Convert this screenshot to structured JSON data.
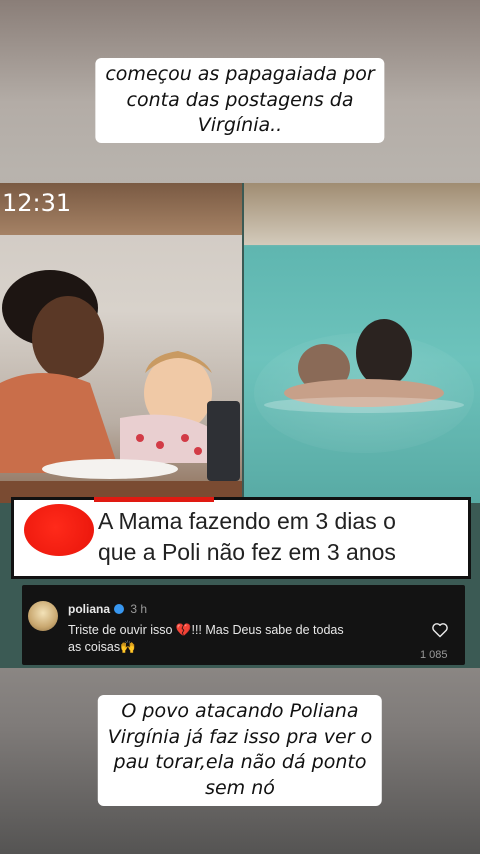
{
  "caption_top": {
    "lines": [
      "começou as papagaiada por",
      "conta das postagens da",
      "Virgínia.."
    ]
  },
  "video": {
    "status_time": "12:31"
  },
  "comment": {
    "lines": [
      "A Mama fazendo em 3 dias o",
      "que a Poli não fez em 3 anos"
    ]
  },
  "reply": {
    "username": "poliana",
    "time": "3 h",
    "lines": [
      "Triste de ouvir isso 💔!!! Mas Deus sabe de todas",
      "as coisas🙌"
    ],
    "like_count": "1 085"
  },
  "caption_bottom": {
    "lines": [
      "O povo atacando Poliana",
      "Virgínia já faz isso pra ver o",
      "pau torar,ela não dá ponto",
      "sem nó"
    ]
  },
  "colors": {
    "caption_bg": "#ffffff",
    "comment_redaction": "#e8140a",
    "reply_bg": "#131313",
    "verified": "#3897f0"
  }
}
